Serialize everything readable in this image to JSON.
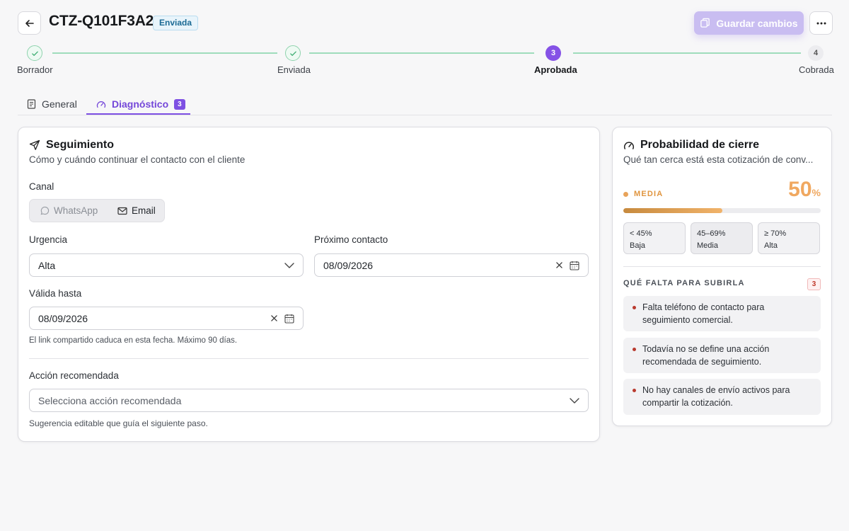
{
  "header": {
    "title": "CTZ-Q101F3A2",
    "status": "Enviada",
    "save_label": "Guardar cambios"
  },
  "stepper": {
    "steps": [
      {
        "label": "Borrador",
        "state": "done",
        "number": ""
      },
      {
        "label": "Enviada",
        "state": "done",
        "number": ""
      },
      {
        "label": "Aprobada",
        "state": "active",
        "number": "3"
      },
      {
        "label": "Cobrada",
        "state": "pending",
        "number": "4"
      }
    ]
  },
  "tabs": [
    {
      "label": "General",
      "active": false
    },
    {
      "label": "Diagnóstico",
      "active": true,
      "count": "3"
    }
  ],
  "followup": {
    "title": "Seguimiento",
    "subtitle": "Cómo y cuándo continuar el contacto con el cliente",
    "channel_label": "Canal",
    "channels": [
      {
        "label": "WhatsApp",
        "selected": false
      },
      {
        "label": "Email",
        "selected": true
      }
    ],
    "urgency_label": "Urgencia",
    "urgency_value": "Alta",
    "next_contact_label": "Próximo contacto",
    "next_contact_value": "08/09/2026",
    "valid_until_label": "Válida hasta",
    "valid_until_value": "08/09/2026",
    "valid_until_hint": "El link compartido caduca en esta fecha. Máximo 90 días.",
    "action_label": "Acción recomendada",
    "action_placeholder": "Selecciona acción recomendada",
    "action_hint": "Sugerencia editable que guía el siguiente paso."
  },
  "probability": {
    "title": "Probabilidad de cierre",
    "subtitle": "Qué tan cerca está esta cotización de conv...",
    "level": "MEDIA",
    "value": "50",
    "unit": "%",
    "fraction": 0.5,
    "ranges": [
      {
        "range": "< 45%",
        "name": "Baja"
      },
      {
        "range": "45–69%",
        "name": "Media"
      },
      {
        "range": "≥ 70%",
        "name": "Alta"
      }
    ],
    "missing_title": "QUÉ FALTA PARA SUBIRLA",
    "missing_count": "3",
    "missing": [
      "Falta teléfono de contacto para seguimiento comercial.",
      "Todavía no se define una acción recomendada de seguimiento.",
      "No hay canales de envío activos para compartir la cotización."
    ]
  },
  "colors": {
    "accent": "#7e50e3",
    "success": "#9fdcbc",
    "warning": "#f0a860",
    "danger": "#b93a2e"
  },
  "icons": [
    "arrow-left-icon",
    "copy-icon",
    "more-horizontal-icon",
    "check-icon",
    "document-icon",
    "gauge-icon",
    "send-icon",
    "message-circle-icon",
    "mail-icon",
    "chevron-down-icon",
    "close-icon",
    "calendar-icon"
  ]
}
